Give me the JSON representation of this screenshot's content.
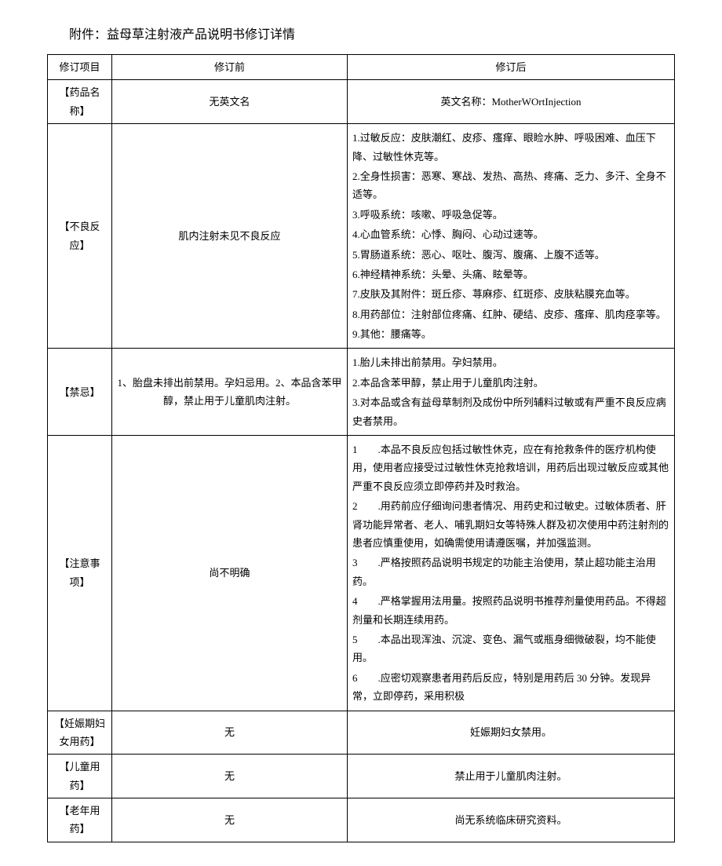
{
  "title": "附件：益母草注射液产品说明书修订详情",
  "headers": {
    "col1": "修订项目",
    "col2": "修订前",
    "col3": "修订后"
  },
  "rows": {
    "name": {
      "label": "【药品名称】",
      "before": "无英文名",
      "after": "英文名称：MotherWOrtInjection"
    },
    "adverse": {
      "label": "【不良反应】",
      "before": "肌内注射未见不良反应",
      "after": [
        "1.过敏反应：皮肤潮红、皮疹、瘙痒、眼睑水肿、呼吸困难、血压下降、过敏性休克等。",
        "2.全身性损害：恶寒、寒战、发热、高热、疼痛、乏力、多汗、全身不适等。",
        "3.呼吸系统：咳嗽、呼吸急促等。",
        "4.心血管系统：心悸、胸闷、心动过速等。",
        "5.胃肠道系统：恶心、呕吐、腹泻、腹痛、上腹不适等。",
        "6.神经精神系统：头晕、头痛、眩晕等。",
        "7.皮肤及其附件：斑丘疹、荨麻疹、红斑疹、皮肤粘膜充血等。",
        "8.用药部位：注射部位疼痛、红肿、硬结、皮疹、瘙痒、肌肉痉挛等。",
        "9.其他：腰痛等。"
      ]
    },
    "contra": {
      "label": "【禁忌】",
      "before": "1、胎盘未排出前禁用。孕妇忌用。2、本品含苯甲醇，禁止用于儿童肌肉注射。",
      "after": [
        "1.胎儿未排出前禁用。孕妇禁用。",
        "2.本品含苯甲醇，禁止用于儿童肌肉注射。",
        "3.对本品或含有益母草制剂及成份中所列辅料过敏或有严重不良反应病史者禁用。"
      ]
    },
    "caution": {
      "label": "【注意事项】",
      "before": "尚不明确",
      "after": [
        "1　　.本品不良反应包括过敏性休克，应在有抢救条件的医疗机构使用，使用者应接受过过敏性休克抢救培训，用药后出现过敏反应或其他严重不良反应须立即停药并及时救治。",
        "2　　.用药前应仔细询问患者情况、用药史和过敏史。过敏体质者、肝肾功能异常者、老人、哺乳期妇女等特殊人群及初次使用中药注射剂的患者应慎重使用，如确需使用请遵医嘱，并加强监测。",
        "3　　.严格按照药品说明书规定的功能主治使用，禁止超功能主治用药。",
        "4　　.严格掌握用法用量。按照药品说明书推荐剂量使用药品。不得超剂量和长期连续用药。",
        "5　　.本品出现浑浊、沉淀、变色、漏气或瓶身细微破裂，均不能使用。",
        "6　　.应密切观察患者用药后反应，特别是用药后 30 分钟。发现异常，立即停药，采用积极"
      ]
    },
    "pregnancy": {
      "label": "【妊娠期妇女用药】",
      "before": "无",
      "after": "妊娠期妇女禁用。"
    },
    "child": {
      "label": "【儿童用药】",
      "before": "无",
      "after": "禁止用于儿童肌肉注射。"
    },
    "elderly": {
      "label": "【老年用药】",
      "before": "无",
      "after": "尚无系统临床研究资料。"
    }
  }
}
